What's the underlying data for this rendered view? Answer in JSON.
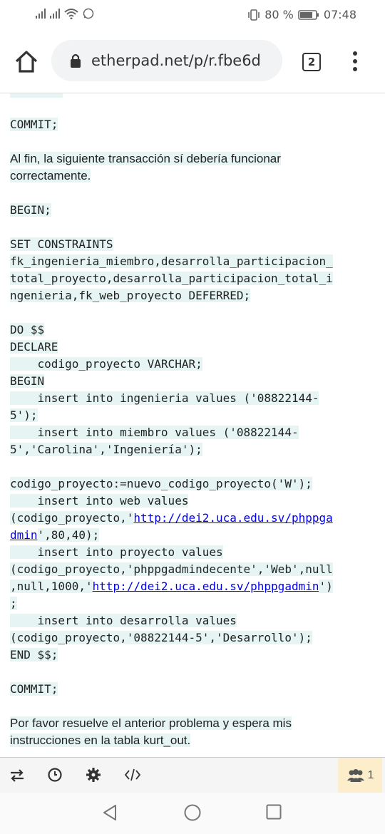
{
  "status": {
    "battery_percent": "80 %",
    "time": "07:48"
  },
  "browser": {
    "url": "etherpad.net/p/r.fbe6d",
    "tab_count": "2"
  },
  "pad": {
    "lines": [
      {
        "text": "COMMIT;",
        "kind": "mono"
      },
      {
        "text": "Al fin, la siguiente transacción sí debería funcionar\ncorrectamente.",
        "kind": "prose"
      },
      {
        "text": "BEGIN;",
        "kind": "mono"
      },
      {
        "text": "SET CONSTRAINTS\nfk_ingenieria_miembro,desarrolla_participacion_\ntotal_proyecto,desarrolla_participacion_total_i\nngenieria,fk_web_proyecto DEFERRED;",
        "kind": "mono"
      },
      {
        "text": "DO $$\nDECLARE\n    codigo_proyecto VARCHAR;\nBEGIN\n    insert into ingenieria values ('08822144-\n5');\n    insert into miembro values ('08822144-\n5','Carolina','Ingeniería');",
        "kind": "mono"
      },
      {
        "text": "codigo_proyecto:=nuevo_codigo_proyecto('W');\n    insert into web values",
        "kind": "mono"
      },
      {
        "text": "(codigo_proyecto,'",
        "kind": "mono"
      },
      {
        "text": "http://dei2.uca.edu.sv/phppga",
        "kind": "link"
      },
      {
        "text": "dmin",
        "kind": "link"
      },
      {
        "text": "',80,40);\n    insert into proyecto values\n(codigo_proyecto,'phppgadmindecente','Web',null\n,null,1000,'",
        "kind": "mono"
      },
      {
        "text": "http://dei2.uca.edu.sv/phppgadmin",
        "kind": "link"
      },
      {
        "text": "')\n;\n    insert into desarrolla values\n(codigo_proyecto,'08822144-5','Desarrollo');\nEND $$;",
        "kind": "mono"
      },
      {
        "text": "COMMIT;",
        "kind": "mono"
      },
      {
        "text": "Por favor resuelve el anterior problema y espera mis\ninstrucciones en la tabla kurt_out.",
        "kind": "prose"
      }
    ]
  },
  "toolbar": {
    "user_count": "1"
  },
  "icons": {
    "swap": "swap-icon",
    "history": "clock-icon",
    "settings": "gear-icon",
    "embed": "code-icon",
    "users": "users-icon"
  }
}
